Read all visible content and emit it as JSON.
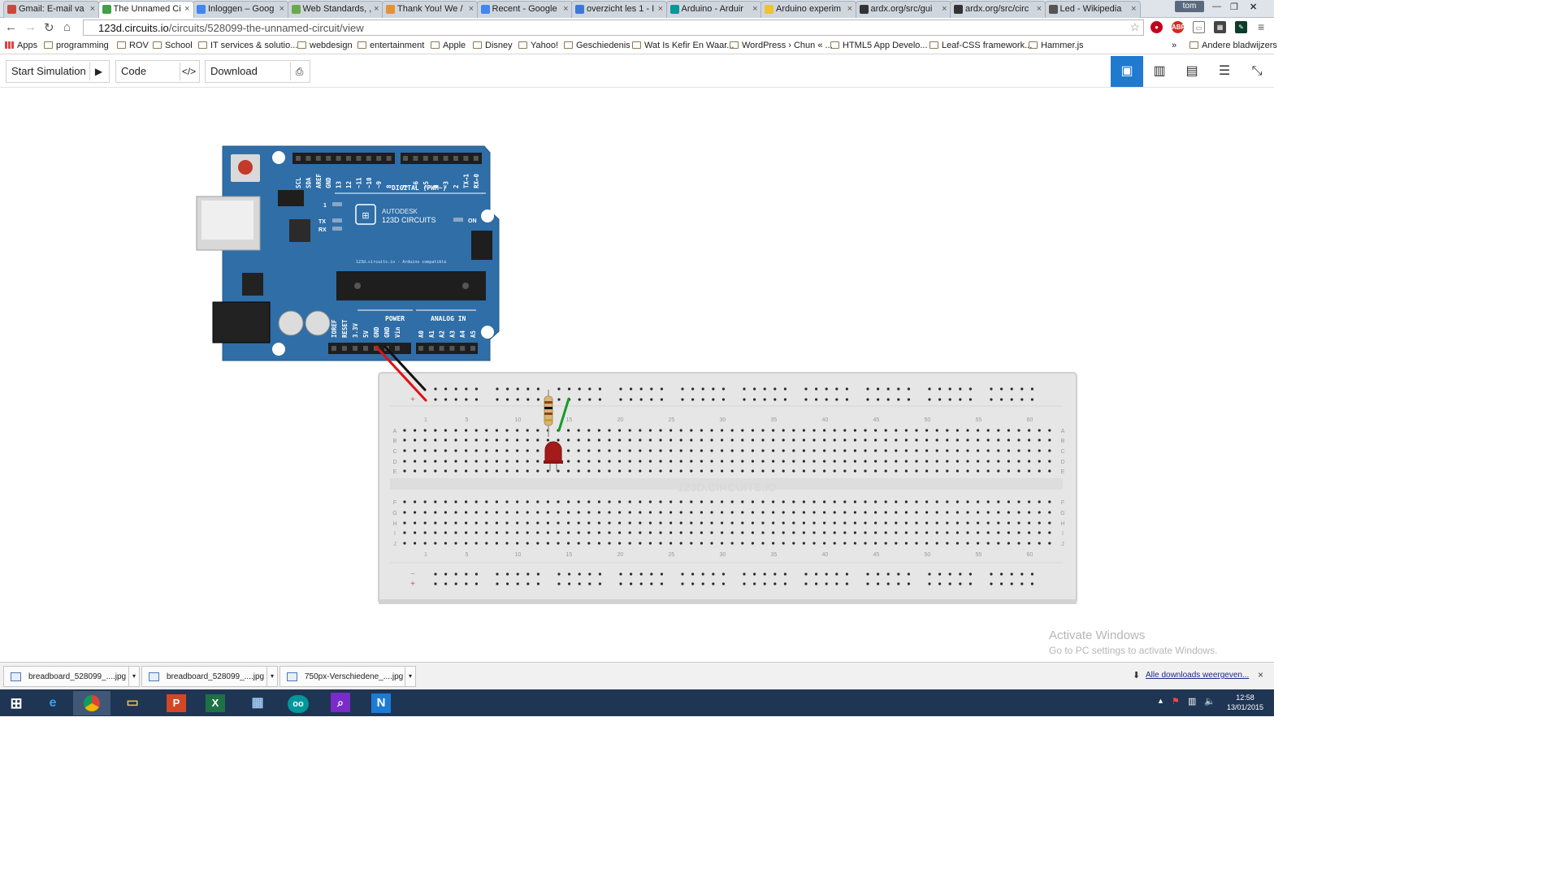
{
  "browser": {
    "tabs": [
      {
        "title": "Gmail: E-mail va",
        "active": false
      },
      {
        "title": "The Unnamed Ci",
        "active": true
      },
      {
        "title": "Inloggen – Goog",
        "active": false
      },
      {
        "title": "Web Standards, ,",
        "active": false
      },
      {
        "title": "Thank You! We /",
        "active": false
      },
      {
        "title": "Recent - Google",
        "active": false
      },
      {
        "title": "overzicht les 1 - I",
        "active": false
      },
      {
        "title": "Arduino - Arduir",
        "active": false
      },
      {
        "title": "Arduino experim",
        "active": false
      },
      {
        "title": "ardx.org/src/gui",
        "active": false
      },
      {
        "title": "ardx.org/src/circ",
        "active": false
      },
      {
        "title": "Led - Wikipedia",
        "active": false
      }
    ],
    "user": "tom",
    "url_host": "123d.circuits.io",
    "url_path": "/circuits/528099-the-unnamed-circuit/view",
    "bookmarks": [
      "Apps",
      "programming",
      "ROV",
      "School",
      "IT services & solutio...",
      "webdesign",
      "entertainment",
      "Apple",
      "Disney",
      "Yahoo!",
      "Geschiedenis",
      "Wat Is Kefir En Waar...",
      "WordPress › Chun « ...",
      "HTML5 App Develo...",
      "Leaf-CSS framework...",
      "Hammer.js"
    ],
    "bookmarks_overflow": "»",
    "other_bookmarks": "Andere bladwijzers"
  },
  "app_toolbar": {
    "start_simulation": "Start Simulation",
    "code_editor": "Code Editor",
    "download_image": "Download Image"
  },
  "arduino": {
    "brand_top": "AUTODESK",
    "brand_bottom": "123D CIRCUITS",
    "digital_label": "DIGITAL (PWM~)",
    "power_label": "POWER",
    "analog_label": "ANALOG IN",
    "site_label": "123d.circuits.io - Arduino compatible",
    "on_label": "ON",
    "tx_label": "TX",
    "rx_label": "RX",
    "l_label": "1",
    "top_pins": [
      "SCL",
      "SDA",
      "AREF",
      "GND",
      "13",
      "12",
      "~11",
      "~10",
      "~9",
      "8",
      "7",
      "~6",
      "~5",
      "4",
      "~3",
      "2",
      "TX→1",
      "RX←0"
    ],
    "power_pins": [
      "IOREF",
      "RESET",
      "3.3V",
      "5V",
      "GND",
      "GND",
      "Vin"
    ],
    "analog_pins": [
      "A0",
      "A1",
      "A2",
      "A3",
      "A4",
      "A5"
    ]
  },
  "breadboard": {
    "watermark": "123D.CIRCUITS.IO",
    "column_numbers": [
      "1",
      "5",
      "10",
      "15",
      "20",
      "25",
      "30",
      "35",
      "40",
      "45",
      "50",
      "55",
      "60"
    ],
    "rows_top": [
      "A",
      "B",
      "C",
      "D",
      "E"
    ],
    "rows_bottom": [
      "F",
      "G",
      "H",
      "I",
      "J"
    ],
    "plus": "+",
    "minus": "−"
  },
  "windows_activation": {
    "title": "Activate Windows",
    "subtitle": "Go to PC settings to activate Windows."
  },
  "downloads": {
    "items": [
      "breadboard_528099_....jpg",
      "breadboard_528099_....jpg",
      "750px-Verschiedene_....jpg"
    ],
    "show_all": "Alle downloads weergeven...",
    "close": "×"
  },
  "taskbar": {
    "time": "12:58",
    "date": "13/01/2015"
  },
  "colors": {
    "arduino_blue": "#2f6ea7",
    "wire_red": "#e01010",
    "wire_black": "#111111",
    "wire_green": "#1a9a28",
    "led_red": "#a51a1a",
    "accent": "#1f7ad0"
  }
}
